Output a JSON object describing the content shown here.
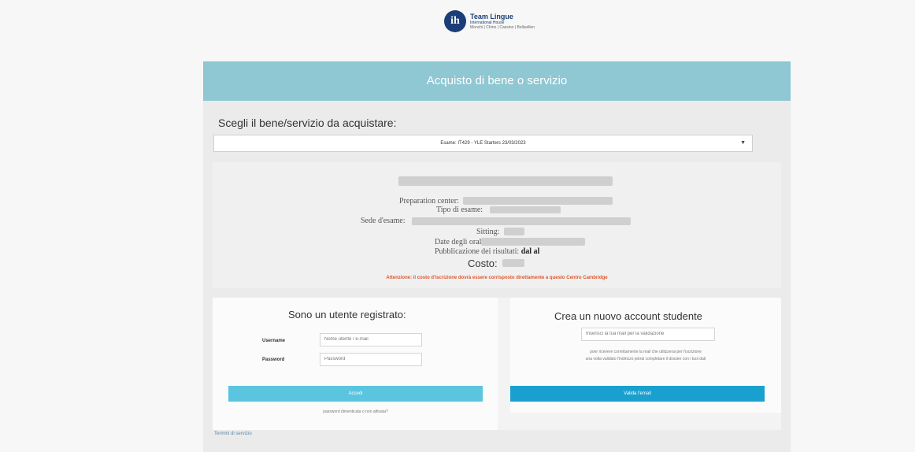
{
  "logo": {
    "mark": "ih",
    "name": "Team Lingue",
    "subtitle": "International House",
    "tagline": "Monchi | Chino | Cassino | Bellavillen"
  },
  "header": {
    "title": "Acquisto di bene o servizio"
  },
  "purchase": {
    "choose_label": "Scegli il bene/servizio da acquistare:",
    "selected_option": "Esame: IT429 - YLE Starters 23/03/2023"
  },
  "exam_info": {
    "preparation_center_label": "Preparation center:",
    "exam_type_label": "Tipo di esame:",
    "exam_venue_label": "Sede d'esame:",
    "sitting_label": "Sitting:",
    "oral_dates_label": "Date degli orali:",
    "results_label": "Pubblicazione dei risultati:",
    "results_value": "dal al",
    "cost_label": "Costo:",
    "warning": "Attenzione: il costo d'iscrizione dovrà essere corrisposto direttamente a questo Centro Cambridge"
  },
  "login": {
    "title": "Sono un utente registrato:",
    "username_label": "Username",
    "username_placeholder": "Nome utente / e-mail",
    "password_label": "Password",
    "password_placeholder": "Password",
    "submit_label": "Accedi",
    "forgot_label": "password dimenticata o non attivata?"
  },
  "signup": {
    "title": "Crea un nuovo account studente",
    "email_placeholder": "Inserisci la tua mail per la validazione",
    "hint_line1": "poer ricevere correttamente la mail che utilizzerai per l'iscrizione",
    "hint_line2": "una volta validato l'indirizzo potrai completare il dossier con i tuoi dati",
    "submit_label": "Valida l'email"
  },
  "footer": {
    "link_label": "Termini di servizio"
  }
}
